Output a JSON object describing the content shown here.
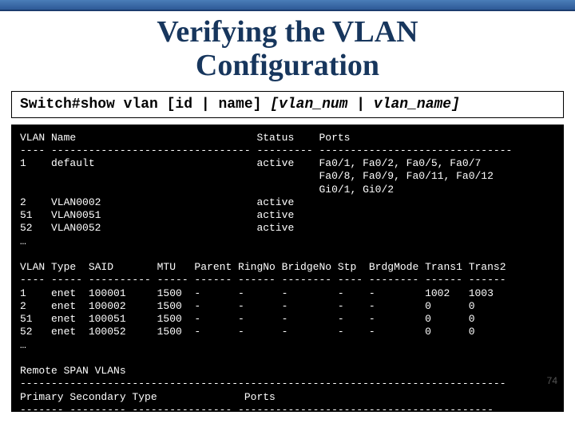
{
  "title_line1": "Verifying the VLAN",
  "title_line2": "Configuration",
  "command_plain": "Switch#show vlan [id | name] ",
  "command_italic": "[vlan_num | vlan_name]",
  "page_number": "74",
  "section1": {
    "header": "VLAN Name                             Status    Ports",
    "divider": "---- -------------------------------- --------- -------------------------------",
    "rows": [
      "1    default                          active    Fa0/1, Fa0/2, Fa0/5, Fa0/7",
      "                                                Fa0/8, Fa0/9, Fa0/11, Fa0/12",
      "                                                Gi0/1, Gi0/2",
      "2    VLAN0002                         active",
      "51   VLAN0051                         active",
      "52   VLAN0052                         active",
      "…"
    ]
  },
  "section2": {
    "header": "VLAN Type  SAID       MTU   Parent RingNo BridgeNo Stp  BrdgMode Trans1 Trans2",
    "divider": "---- ----- ---------- ----- ------ ------ -------- ---- -------- ------ ------",
    "rows": [
      "1    enet  100001     1500  -      -      -        -    -        1002   1003",
      "2    enet  100002     1500  -      -      -        -    -        0      0",
      "51   enet  100051     1500  -      -      -        -    -        0      0",
      "52   enet  100052     1500  -      -      -        -    -        0      0",
      "…"
    ]
  },
  "section3": {
    "title": "Remote SPAN VLANs",
    "divider": "------------------------------------------------------------------------------",
    "header": "Primary Secondary Type              Ports",
    "divider2": "------- --------- ---------------- -----------------------------------------"
  }
}
